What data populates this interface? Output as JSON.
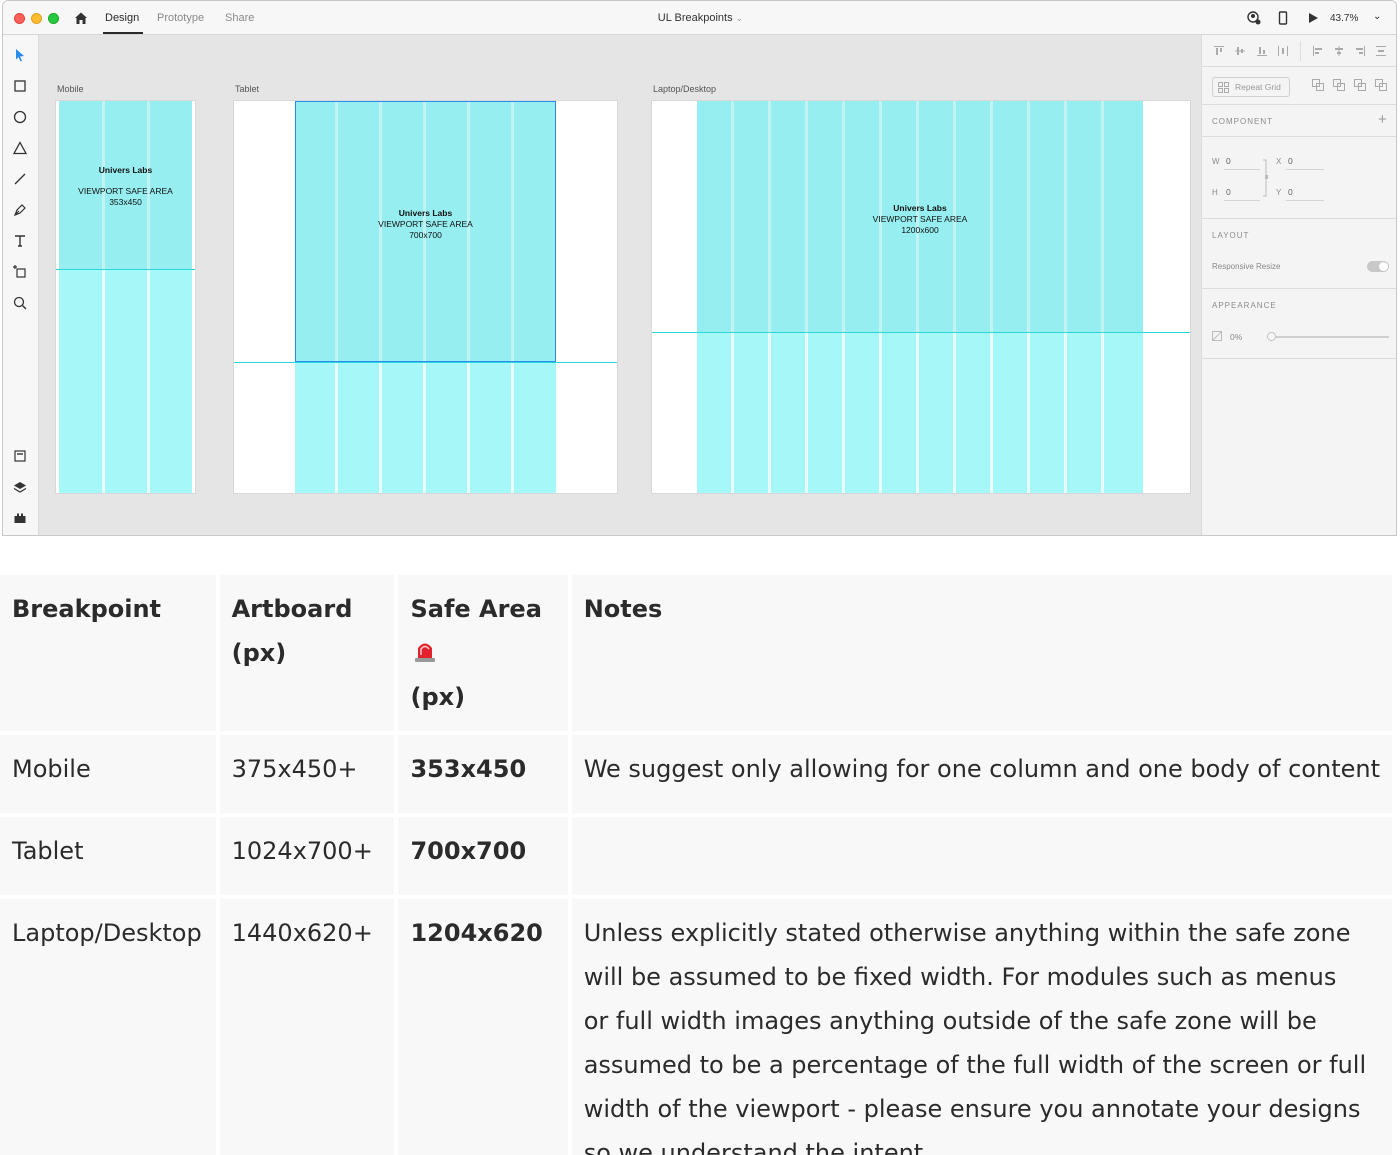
{
  "app": {
    "tabs": [
      "Design",
      "Prototype",
      "Share"
    ],
    "active_tab": "Design",
    "document_title": "UL Breakpoints",
    "zoom": "43.7%"
  },
  "toolbar": {
    "tools": [
      "select-tool",
      "rectangle-tool",
      "ellipse-tool",
      "polygon-tool",
      "line-tool",
      "pen-tool",
      "text-tool",
      "artboard-tool",
      "zoom-tool"
    ],
    "bottom_tools": [
      "assets-icon",
      "layers-icon",
      "plugins-icon"
    ]
  },
  "artboards": [
    {
      "label": "Mobile",
      "brand": "Univers Labs",
      "safe_label": "VIEWPORT SAFE AREA",
      "safe_size": "353x450"
    },
    {
      "label": "Tablet",
      "brand": "Univers Labs",
      "safe_label": "VIEWPORT SAFE AREA",
      "safe_size": "700x700"
    },
    {
      "label": "Laptop/Desktop",
      "brand": "Univers Labs",
      "safe_label": "VIEWPORT SAFE AREA",
      "safe_size": "1200x600"
    }
  ],
  "panel": {
    "repeat_grid": "Repeat Grid",
    "component": "COMPONENT",
    "w_label": "W",
    "w_value": "0",
    "h_label": "H",
    "h_value": "0",
    "x_label": "X",
    "x_value": "0",
    "y_label": "Y",
    "y_value": "0",
    "layout": "LAYOUT",
    "responsive_resize": "Responsive Resize",
    "appearance": "APPEARANCE",
    "opacity": "0%",
    "accent": "#2a8cf0"
  },
  "table": {
    "headers": [
      "Breakpoint",
      "Artboard (px)",
      "Safe Area",
      "(px)",
      "Notes"
    ],
    "rows": [
      {
        "breakpoint": "Mobile",
        "artboard": "375x450+",
        "safe_area": "353x450",
        "notes": "We suggest only allowing for one column and one body of content"
      },
      {
        "breakpoint": "Tablet",
        "artboard": "1024x700+",
        "safe_area": "700x700",
        "notes": ""
      },
      {
        "breakpoint": "Laptop/Desktop",
        "artboard": "1440x620+",
        "safe_area": "1204x620",
        "notes": "Unless explicitly stated otherwise anything within the safe zone will be assumed to be fixed width. For modules such as menus or full width images anything outside of the safe zone will be assumed to be a percentage of the full width of the screen or full width of the viewport - please ensure you annotate your designs so we understand the intent."
      }
    ]
  }
}
